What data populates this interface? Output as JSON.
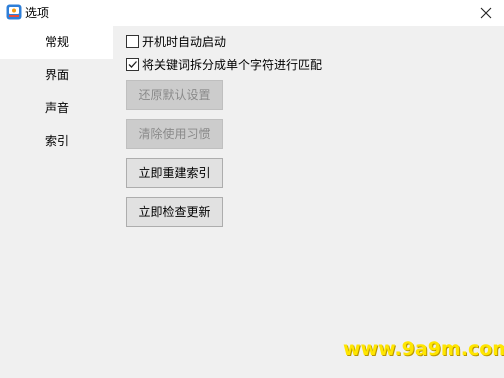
{
  "window": {
    "title": "选项",
    "icon": "app-icon"
  },
  "sidebar": {
    "items": [
      {
        "label": "常规",
        "selected": true
      },
      {
        "label": "界面",
        "selected": false
      },
      {
        "label": "声音",
        "selected": false
      },
      {
        "label": "索引",
        "selected": false
      }
    ]
  },
  "general": {
    "checkboxes": [
      {
        "label": "开机时自动启动",
        "checked": false
      },
      {
        "label": "将关键词拆分成单个字符进行匹配",
        "checked": true
      }
    ],
    "buttons": [
      {
        "label": "还原默认设置",
        "enabled": false
      },
      {
        "label": "清除使用习惯",
        "enabled": false
      },
      {
        "label": "立即重建索引",
        "enabled": true
      },
      {
        "label": "立即检查更新",
        "enabled": true
      }
    ]
  },
  "watermark": "www.9a9m.com",
  "colors": {
    "sidebar_bg": "#f0f0f0",
    "selected_bg": "#ffffff",
    "watermark": "#ffe600"
  }
}
